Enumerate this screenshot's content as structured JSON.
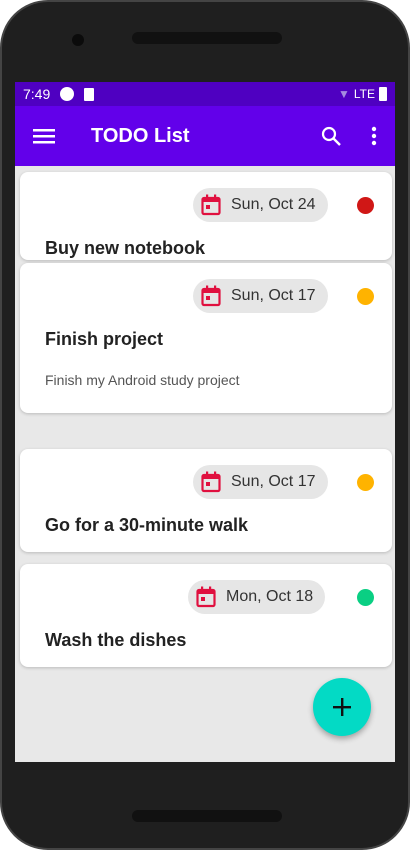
{
  "status": {
    "time": "7:49",
    "network": "LTE"
  },
  "appbar": {
    "title": "TODO List"
  },
  "todos": [
    {
      "date": "Sun, Oct 24",
      "title": "Buy new notebook",
      "description": "",
      "priority_color": "#d01716"
    },
    {
      "date": "Sun, Oct 17",
      "title": "Finish project",
      "description": "Finish my Android study project",
      "priority_color": "#ffb300"
    },
    {
      "date": "Sun, Oct 17",
      "title": "Go for a 30-minute walk",
      "description": "",
      "priority_color": "#ffb300"
    },
    {
      "date": "Mon, Oct 18",
      "title": "Wash the dishes",
      "description": "",
      "priority_color": "#0acf83"
    }
  ],
  "colors": {
    "primary": "#6200ea",
    "accent": "#03dac5"
  }
}
